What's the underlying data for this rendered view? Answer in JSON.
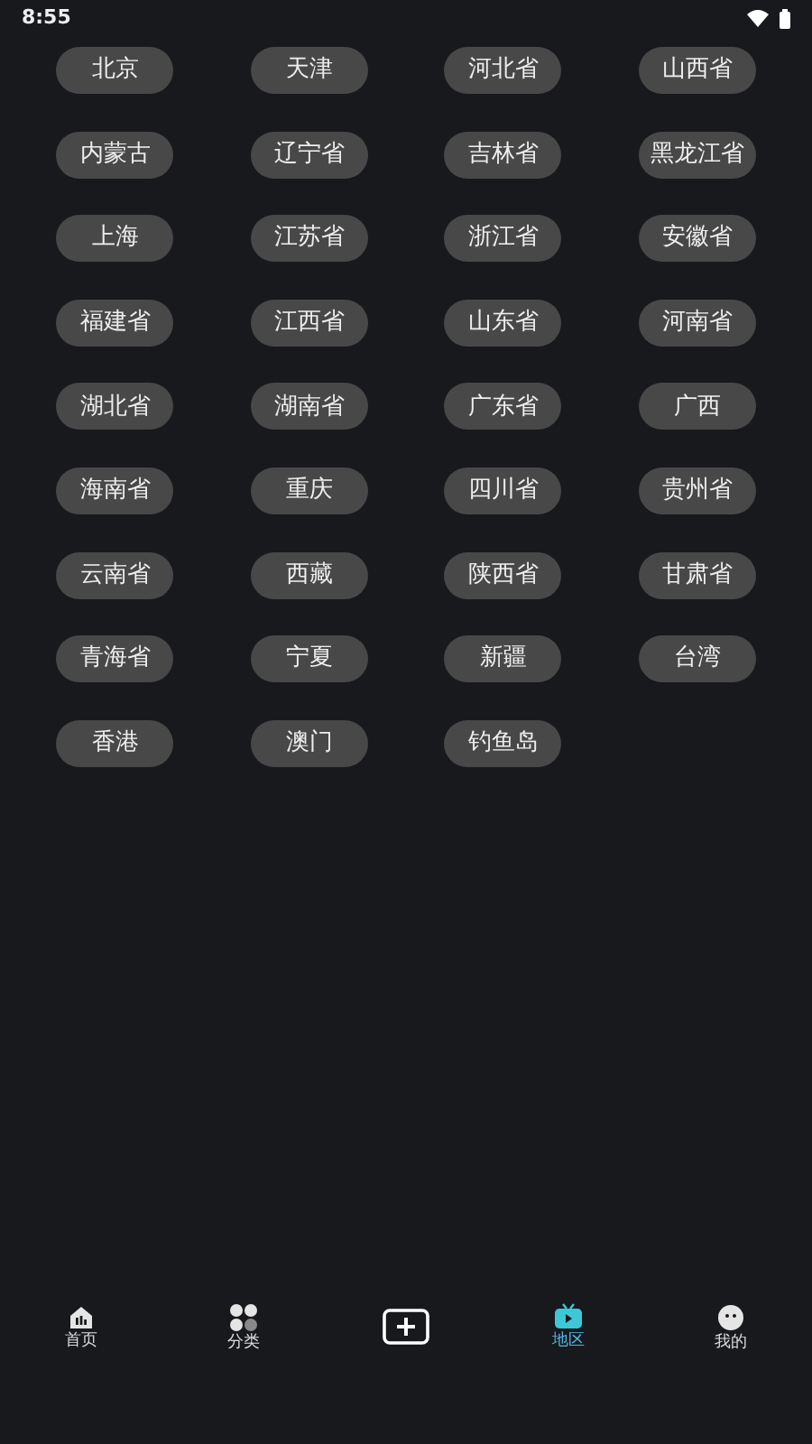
{
  "status_bar": {
    "time": "8:55"
  },
  "regions": [
    {
      "label": "北京"
    },
    {
      "label": "天津"
    },
    {
      "label": "河北省"
    },
    {
      "label": "山西省"
    },
    {
      "label": "内蒙古"
    },
    {
      "label": "辽宁省"
    },
    {
      "label": "吉林省"
    },
    {
      "label": "黑龙江省"
    },
    {
      "label": "上海"
    },
    {
      "label": "江苏省"
    },
    {
      "label": "浙江省"
    },
    {
      "label": "安徽省"
    },
    {
      "label": "福建省"
    },
    {
      "label": "江西省"
    },
    {
      "label": "山东省"
    },
    {
      "label": "河南省"
    },
    {
      "label": "湖北省"
    },
    {
      "label": "湖南省"
    },
    {
      "label": "广东省"
    },
    {
      "label": "广西"
    },
    {
      "label": "海南省"
    },
    {
      "label": "重庆"
    },
    {
      "label": "四川省"
    },
    {
      "label": "贵州省"
    },
    {
      "label": "云南省"
    },
    {
      "label": "西藏"
    },
    {
      "label": "陕西省"
    },
    {
      "label": "甘肃省"
    },
    {
      "label": "青海省"
    },
    {
      "label": "宁夏"
    },
    {
      "label": "新疆"
    },
    {
      "label": "台湾"
    },
    {
      "label": "香港"
    },
    {
      "label": "澳门"
    },
    {
      "label": "钓鱼岛"
    }
  ],
  "bottom_nav": [
    {
      "kind": "home",
      "label": "首页",
      "selected": false
    },
    {
      "kind": "category",
      "label": "分类",
      "selected": false
    },
    {
      "kind": "add",
      "selected": false
    },
    {
      "kind": "region",
      "label": "地区",
      "selected": true
    },
    {
      "kind": "profile",
      "label": "我的",
      "selected": false
    }
  ]
}
